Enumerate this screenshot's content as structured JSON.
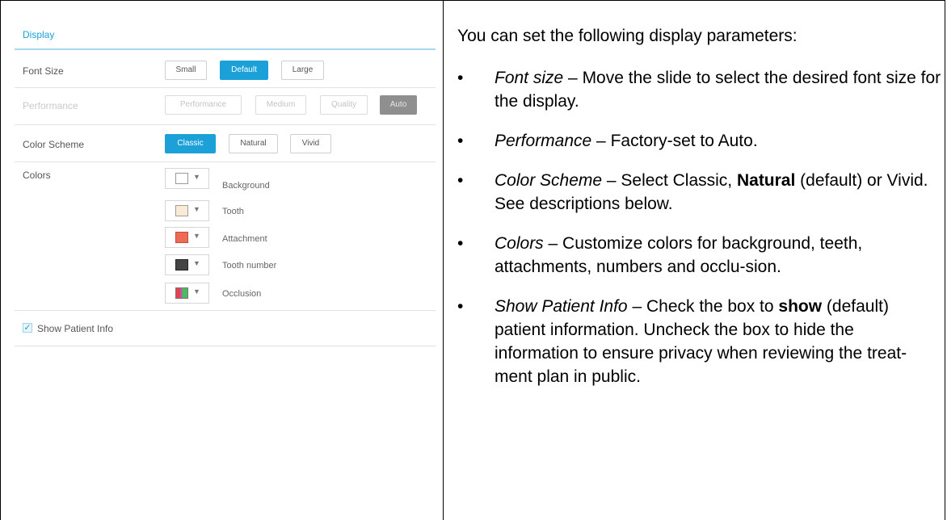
{
  "panel": {
    "title": "Display",
    "font_size": {
      "label": "Font Size",
      "options": [
        "Small",
        "Default",
        "Large"
      ],
      "selected": "Default"
    },
    "performance": {
      "label": "Performance",
      "options": [
        "Performance",
        "Medium",
        "Quality",
        "Auto"
      ],
      "selected": "Auto",
      "enabled": false
    },
    "color_scheme": {
      "label": "Color Scheme",
      "options": [
        "Classic",
        "Natural",
        "Vivid"
      ],
      "selected": "Classic"
    },
    "colors": {
      "label": "Colors",
      "items": [
        {
          "label": "Background",
          "color": "#ffffff"
        },
        {
          "label": "Tooth",
          "color": "#f8ecd9"
        },
        {
          "label": "Attachment",
          "color": "#ee6a55"
        },
        {
          "label": "Tooth number",
          "color": "#444444"
        },
        {
          "label": "Occlusion",
          "color": "gradient-red-green"
        }
      ]
    },
    "show_patient_info": {
      "label": "Show Patient Info",
      "checked": true
    },
    "accent_color": "#1ba1d8"
  },
  "doc": {
    "intro": "You can set the following display parameters:",
    "bullets": [
      {
        "term": "Font size",
        "sep": " – ",
        "text": "Move the slide to select the desired font size for the display."
      },
      {
        "term": "Performance",
        "sep": " – ",
        "text": "Factory-set to Auto."
      },
      {
        "term": "Color Scheme",
        "sep": " – ",
        "pre": "Select Classic, ",
        "bold": "Natural",
        "post": " (default) or Vivid. See descriptions below."
      },
      {
        "term": "Colors",
        "sep": " – ",
        "text": "Customize colors for background, teeth, attachments, numbers and occlu-sion."
      },
      {
        "term": "Show Patient Info",
        "sep": " – ",
        "pre": "Check the box to ",
        "bold": "show",
        "post": " (default) patient information. Uncheck the box to hide the information to ensure privacy when reviewing the treat-ment plan in public."
      }
    ],
    "bullet_glyph": "•"
  }
}
